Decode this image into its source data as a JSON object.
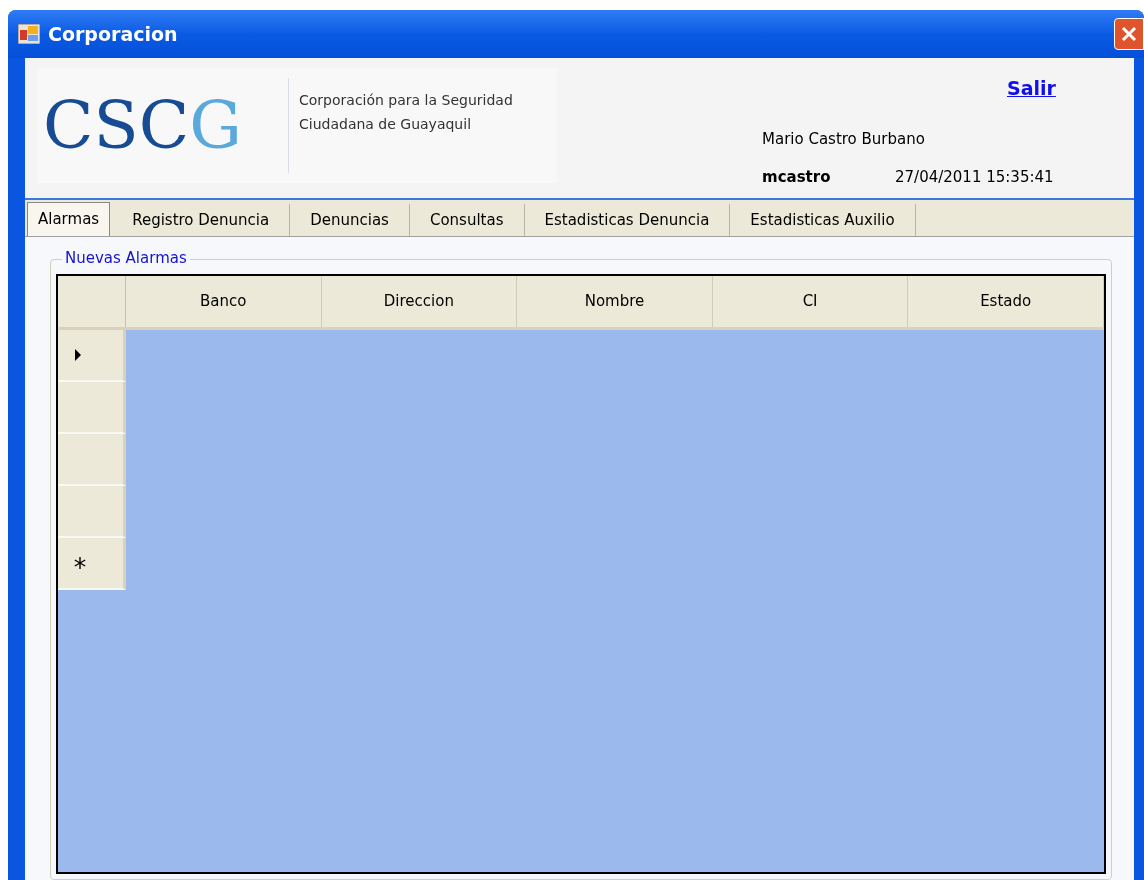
{
  "window": {
    "title": "Corporacion"
  },
  "header": {
    "logo": {
      "main": "CSC",
      "accent": "G"
    },
    "org_lines": [
      "Corporación para la Seguridad",
      "Ciudadana de Guayaquil"
    ],
    "logout_link": "Salir",
    "user_full_name": "Mario Castro Burbano",
    "username": "mcastro",
    "datetime": "27/04/2011 15:35:41"
  },
  "tabs": [
    {
      "label": "Alarmas",
      "selected": true
    },
    {
      "label": "Registro Denuncia",
      "selected": false
    },
    {
      "label": "Denuncias",
      "selected": false
    },
    {
      "label": "Consultas",
      "selected": false
    },
    {
      "label": "Estadisticas Denuncia",
      "selected": false
    },
    {
      "label": "Estadisticas Auxilio",
      "selected": false
    }
  ],
  "group": {
    "title": "Nuevas Alarmas",
    "table": {
      "columns": [
        "Banco",
        "Direccion",
        "Nombre",
        "CI",
        "Estado"
      ],
      "rows": [
        {
          "kind": "current"
        },
        {
          "kind": "blank"
        },
        {
          "kind": "blank"
        },
        {
          "kind": "blank"
        },
        {
          "kind": "new"
        }
      ]
    }
  }
}
